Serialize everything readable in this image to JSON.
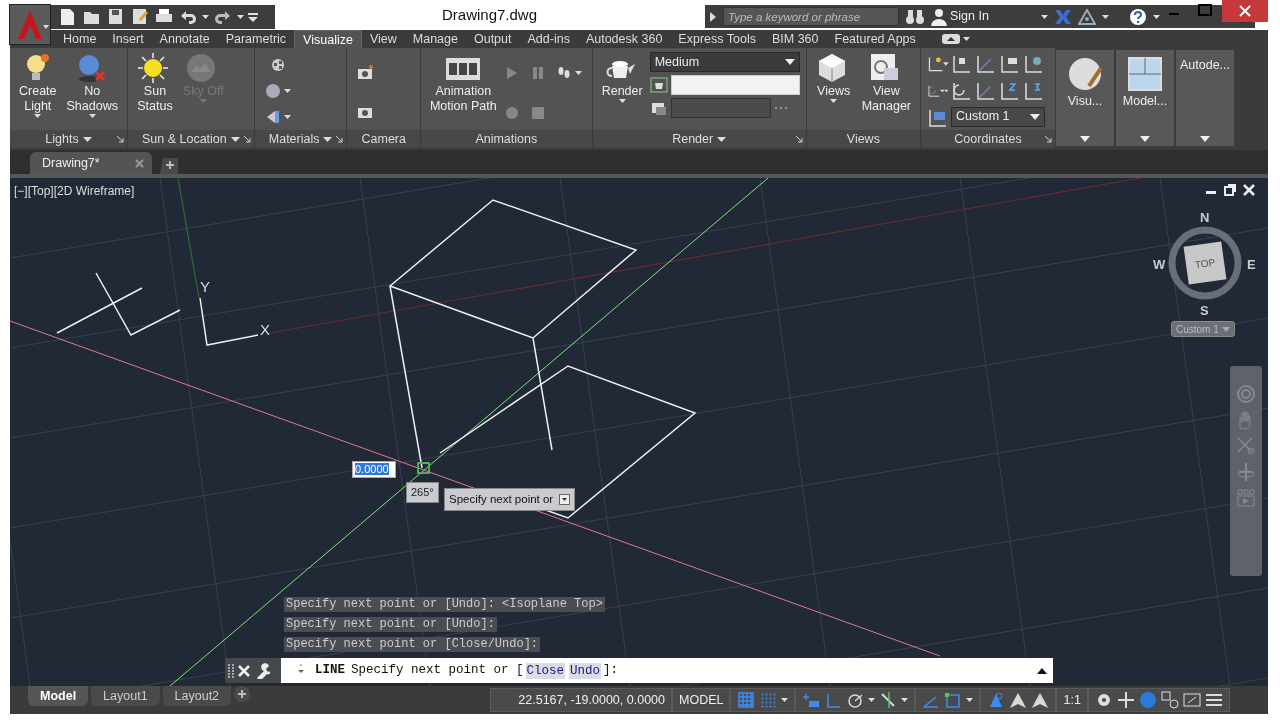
{
  "window": {
    "title": "Drawing7.dwg"
  },
  "search": {
    "placeholder": "Type a keyword or phrase"
  },
  "sign_in": "Sign In",
  "ribbon_tabs": [
    {
      "label": "Home",
      "selected": false
    },
    {
      "label": "Insert",
      "selected": false
    },
    {
      "label": "Annotate",
      "selected": false
    },
    {
      "label": "Parametric",
      "selected": false
    },
    {
      "label": "Visualize",
      "selected": true
    },
    {
      "label": "View",
      "selected": false
    },
    {
      "label": "Manage",
      "selected": false
    },
    {
      "label": "Output",
      "selected": false
    },
    {
      "label": "Add-ins",
      "selected": false
    },
    {
      "label": "Autodesk 360",
      "selected": false
    },
    {
      "label": "Express Tools",
      "selected": false
    },
    {
      "label": "BIM 360",
      "selected": false
    },
    {
      "label": "Featured Apps",
      "selected": false
    }
  ],
  "panels": [
    {
      "title": "Lights",
      "menu": true,
      "launcher": true,
      "tools": [
        {
          "kind": "large",
          "label": "Create\nLight",
          "dropdown": true,
          "disabled": false
        },
        {
          "kind": "large",
          "label": "No\nShadows",
          "dropdown": true,
          "disabled": false
        }
      ]
    },
    {
      "title": "Sun & Location",
      "menu": true,
      "launcher": true,
      "tools": [
        {
          "kind": "large",
          "label": "Sun\nStatus",
          "dropdown": false,
          "disabled": false
        },
        {
          "kind": "large",
          "label": "Sky Off",
          "dropdown": true,
          "disabled": true
        }
      ]
    },
    {
      "title": "Materials",
      "menu": true,
      "launcher": true,
      "tools": [
        {
          "kind": "smallcol"
        }
      ]
    },
    {
      "title": "Camera",
      "menu": false,
      "launcher": false,
      "tools": [
        {
          "kind": "smallcol"
        }
      ]
    },
    {
      "title": "Animations",
      "menu": false,
      "launcher": false,
      "tools": [
        {
          "kind": "large",
          "label": "Animation\nMotion Path",
          "dropdown": false,
          "disabled": false
        },
        {
          "kind": "animgrid"
        }
      ]
    },
    {
      "title": "Render",
      "menu": true,
      "launcher": true,
      "tools": [
        {
          "kind": "large",
          "label": "Render",
          "dropdown": true,
          "disabled": false
        },
        {
          "kind": "renderbox",
          "preset": "Medium"
        }
      ]
    },
    {
      "title": "Views",
      "menu": false,
      "launcher": false,
      "tools": [
        {
          "kind": "large",
          "label": "Views",
          "dropdown": true,
          "disabled": false
        },
        {
          "kind": "large",
          "label": "View\nManager",
          "dropdown": false,
          "disabled": false
        }
      ]
    },
    {
      "title": "Coordinates",
      "menu": false,
      "launcher": true,
      "tools": [
        {
          "kind": "ucsgrid",
          "ucs": "Custom 1"
        }
      ]
    },
    {
      "collapsed": true,
      "label": "Visu..."
    },
    {
      "collapsed": true,
      "label": "Model..."
    },
    {
      "collapsed": true,
      "label": "Autode..."
    }
  ],
  "file_tabs": [
    {
      "label": "Drawing7*",
      "selected": true
    }
  ],
  "viewport": {
    "label": "[−][Top][2D Wireframe]",
    "ucs_y": "Y",
    "ucs_x": "X",
    "viewcube": {
      "north": "N",
      "east": "E",
      "south": "S",
      "west": "W",
      "face": "TOP",
      "ucs": "Custom 1"
    },
    "dynamic_input": {
      "value": "0.0000",
      "angle": "265°",
      "tooltip": "Specify next point or"
    }
  },
  "command_history": [
    "Specify next point or [Undo]:  <Isoplane Top>",
    "Specify next point or [Undo]:",
    "Specify next point or [Close/Undo]:"
  ],
  "command_line": {
    "command": "LINE",
    "prompt": "Specify next point or [",
    "options": [
      "Close",
      "Undo"
    ],
    "suffix": "]:"
  },
  "layout_tabs": [
    {
      "label": "Model",
      "selected": true
    },
    {
      "label": "Layout1",
      "selected": false
    },
    {
      "label": "Layout2",
      "selected": false
    }
  ],
  "status_bar": {
    "coordinates": "22.5167, -19.0000, 0.0000",
    "space": "MODEL",
    "scale": "1:1",
    "toggles": [
      {
        "on": true
      },
      {
        "on": true
      },
      {
        "on": true
      },
      {
        "on": true
      },
      {
        "on": false
      },
      {
        "on": false
      },
      {
        "on": true
      },
      {
        "on": true
      },
      {
        "on": true
      },
      {
        "on": false
      },
      {
        "on": false
      }
    ]
  }
}
